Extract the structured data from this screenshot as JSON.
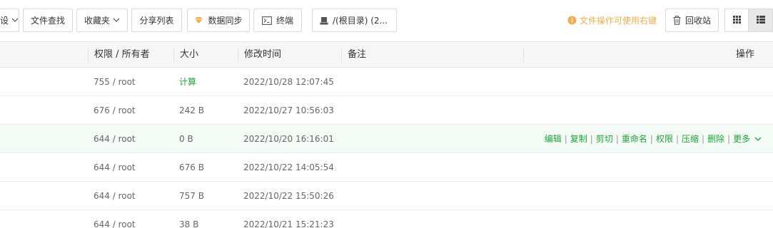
{
  "toolbar": {
    "partial_button_label": "设",
    "file_search": "文件查找",
    "favorites": "收藏夹",
    "share_list": "分享列表",
    "data_sync": "数据同步",
    "terminal": "终端",
    "path": "/(根目录) (2...",
    "hint": "文件操作可使用右键",
    "recycle_bin": "回收站"
  },
  "colors": {
    "accent_green": "#20a53a",
    "warning_orange": "#f0ad4e",
    "sync_icon": "#f0ad4e",
    "underline_red": "#d9001b"
  },
  "icons": {
    "view_grid": "grid-icon",
    "view_list": "list-icon",
    "sync": "diamond-icon",
    "terminal": "terminal-icon",
    "path": "disk-icon",
    "hint": "info-icon",
    "recycle": "trash-icon"
  },
  "table": {
    "headers": {
      "perm_owner": "权限 / 所有者",
      "size": "大小",
      "modified": "修改时间",
      "remark": "备注",
      "actions": "操作"
    },
    "rows": [
      {
        "perm": "755 / root",
        "size": "计算",
        "modified": "2022/10/28 12:07:45",
        "remark": ""
      },
      {
        "perm": "676 / root",
        "size": "242 B",
        "modified": "2022/10/27 10:56:03",
        "remark": ""
      },
      {
        "perm": "644 / root",
        "size": "0 B",
        "modified": "2022/10/20 16:16:01",
        "remark": ""
      },
      {
        "perm": "644 / root",
        "size": "676 B",
        "modified": "2022/10/22 14:05:54",
        "remark": ""
      },
      {
        "perm": "644 / root",
        "size": "757 B",
        "modified": "2022/10/22 15:50:26",
        "remark": ""
      },
      {
        "perm": "644 / root",
        "size": "38 B",
        "modified": "2022/10/21 15:21:23",
        "remark": ""
      }
    ],
    "row_actions": {
      "edit": "编辑",
      "copy": "复制",
      "cut": "剪切",
      "rename": "重命名",
      "permission": "权限",
      "compress": "压缩",
      "delete": "删除",
      "more": "更多",
      "separator": "|"
    }
  }
}
